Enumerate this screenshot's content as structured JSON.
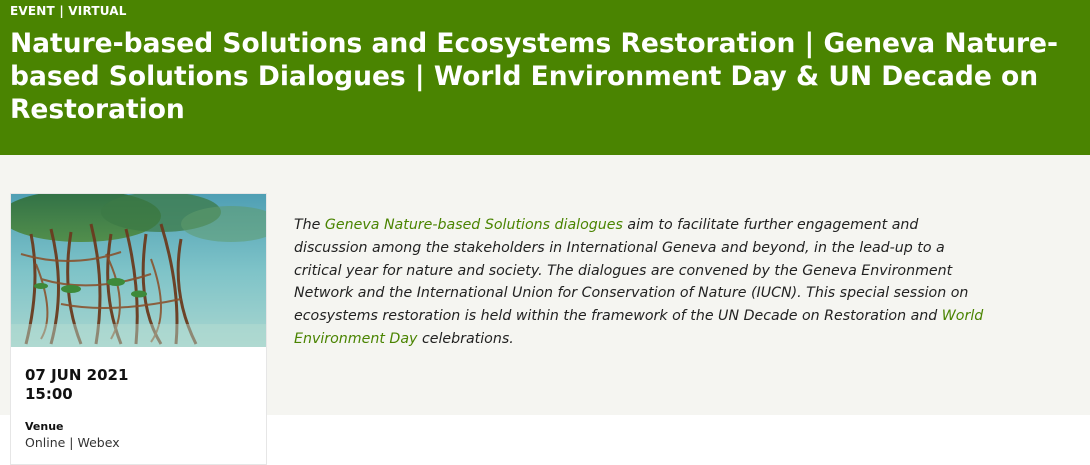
{
  "header": {
    "event_type": "EVENT",
    "separator": "|",
    "format": "VIRTUAL",
    "title": "Nature-based Solutions and Ecosystems Restoration | Geneva Nature-based Solutions Dialogues | World Environment Day & UN Decade on Restoration"
  },
  "card": {
    "image_icon": "mangrove-photo",
    "date": "07 JUN 2021",
    "time": "15:00",
    "venue_label": "Venue",
    "venue_value": "Online | Webex"
  },
  "description": {
    "part1": "The ",
    "link1": "Geneva Nature-based Solutions dialogues",
    "part2": " aim to facilitate further engagement and discussion among the stakeholders in International Geneva and beyond, in the lead-up to a critical year for nature and society. The dialogues are convened by the Geneva Environment Network and the International Union for Conservation of Nature (IUCN). This special session on ecosystems restoration is held within the framework of the UN Decade on Restoration and ",
    "link2": "World Environment Day",
    "part3": " celebrations."
  },
  "colors": {
    "brand_green": "#4a8401",
    "link_green": "#4a8401",
    "content_bg": "#f5f5f1"
  }
}
